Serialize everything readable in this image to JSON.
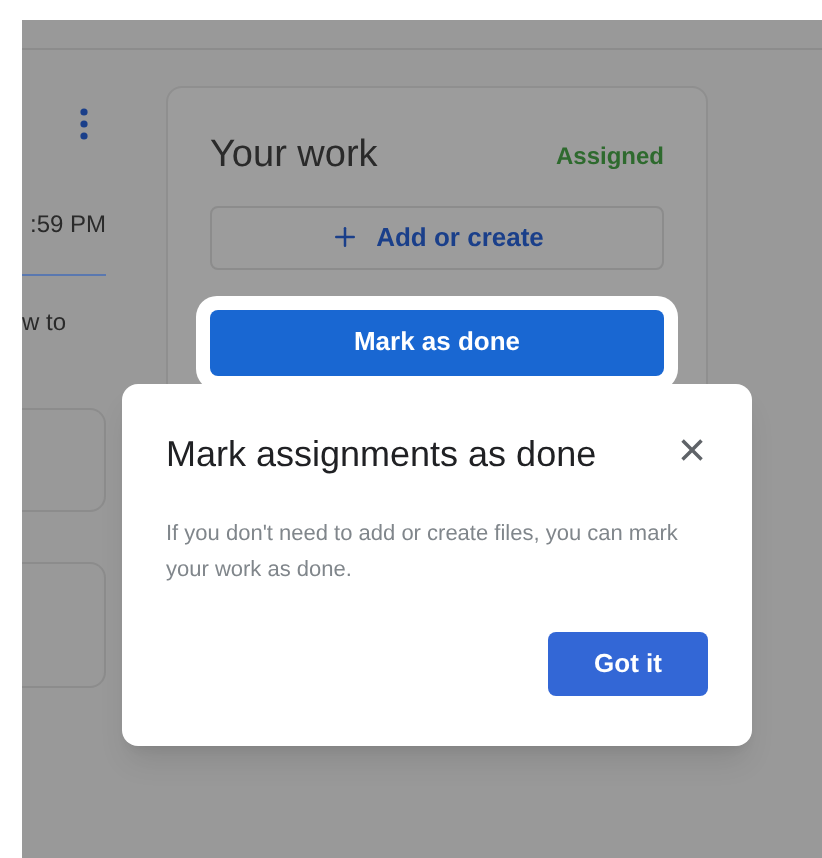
{
  "left_column": {
    "time": ":59 PM",
    "text": "w to"
  },
  "work_card": {
    "title": "Your work",
    "status": "Assigned",
    "add_button": "Add or create",
    "done_button": {
      "label": "Mark as done",
      "highlighted": true
    }
  },
  "dialog": {
    "title": "Mark assignments as done",
    "close": "×",
    "body": "If you don't need to add or create files, you can mark your work as done.",
    "button": "Got it"
  }
}
